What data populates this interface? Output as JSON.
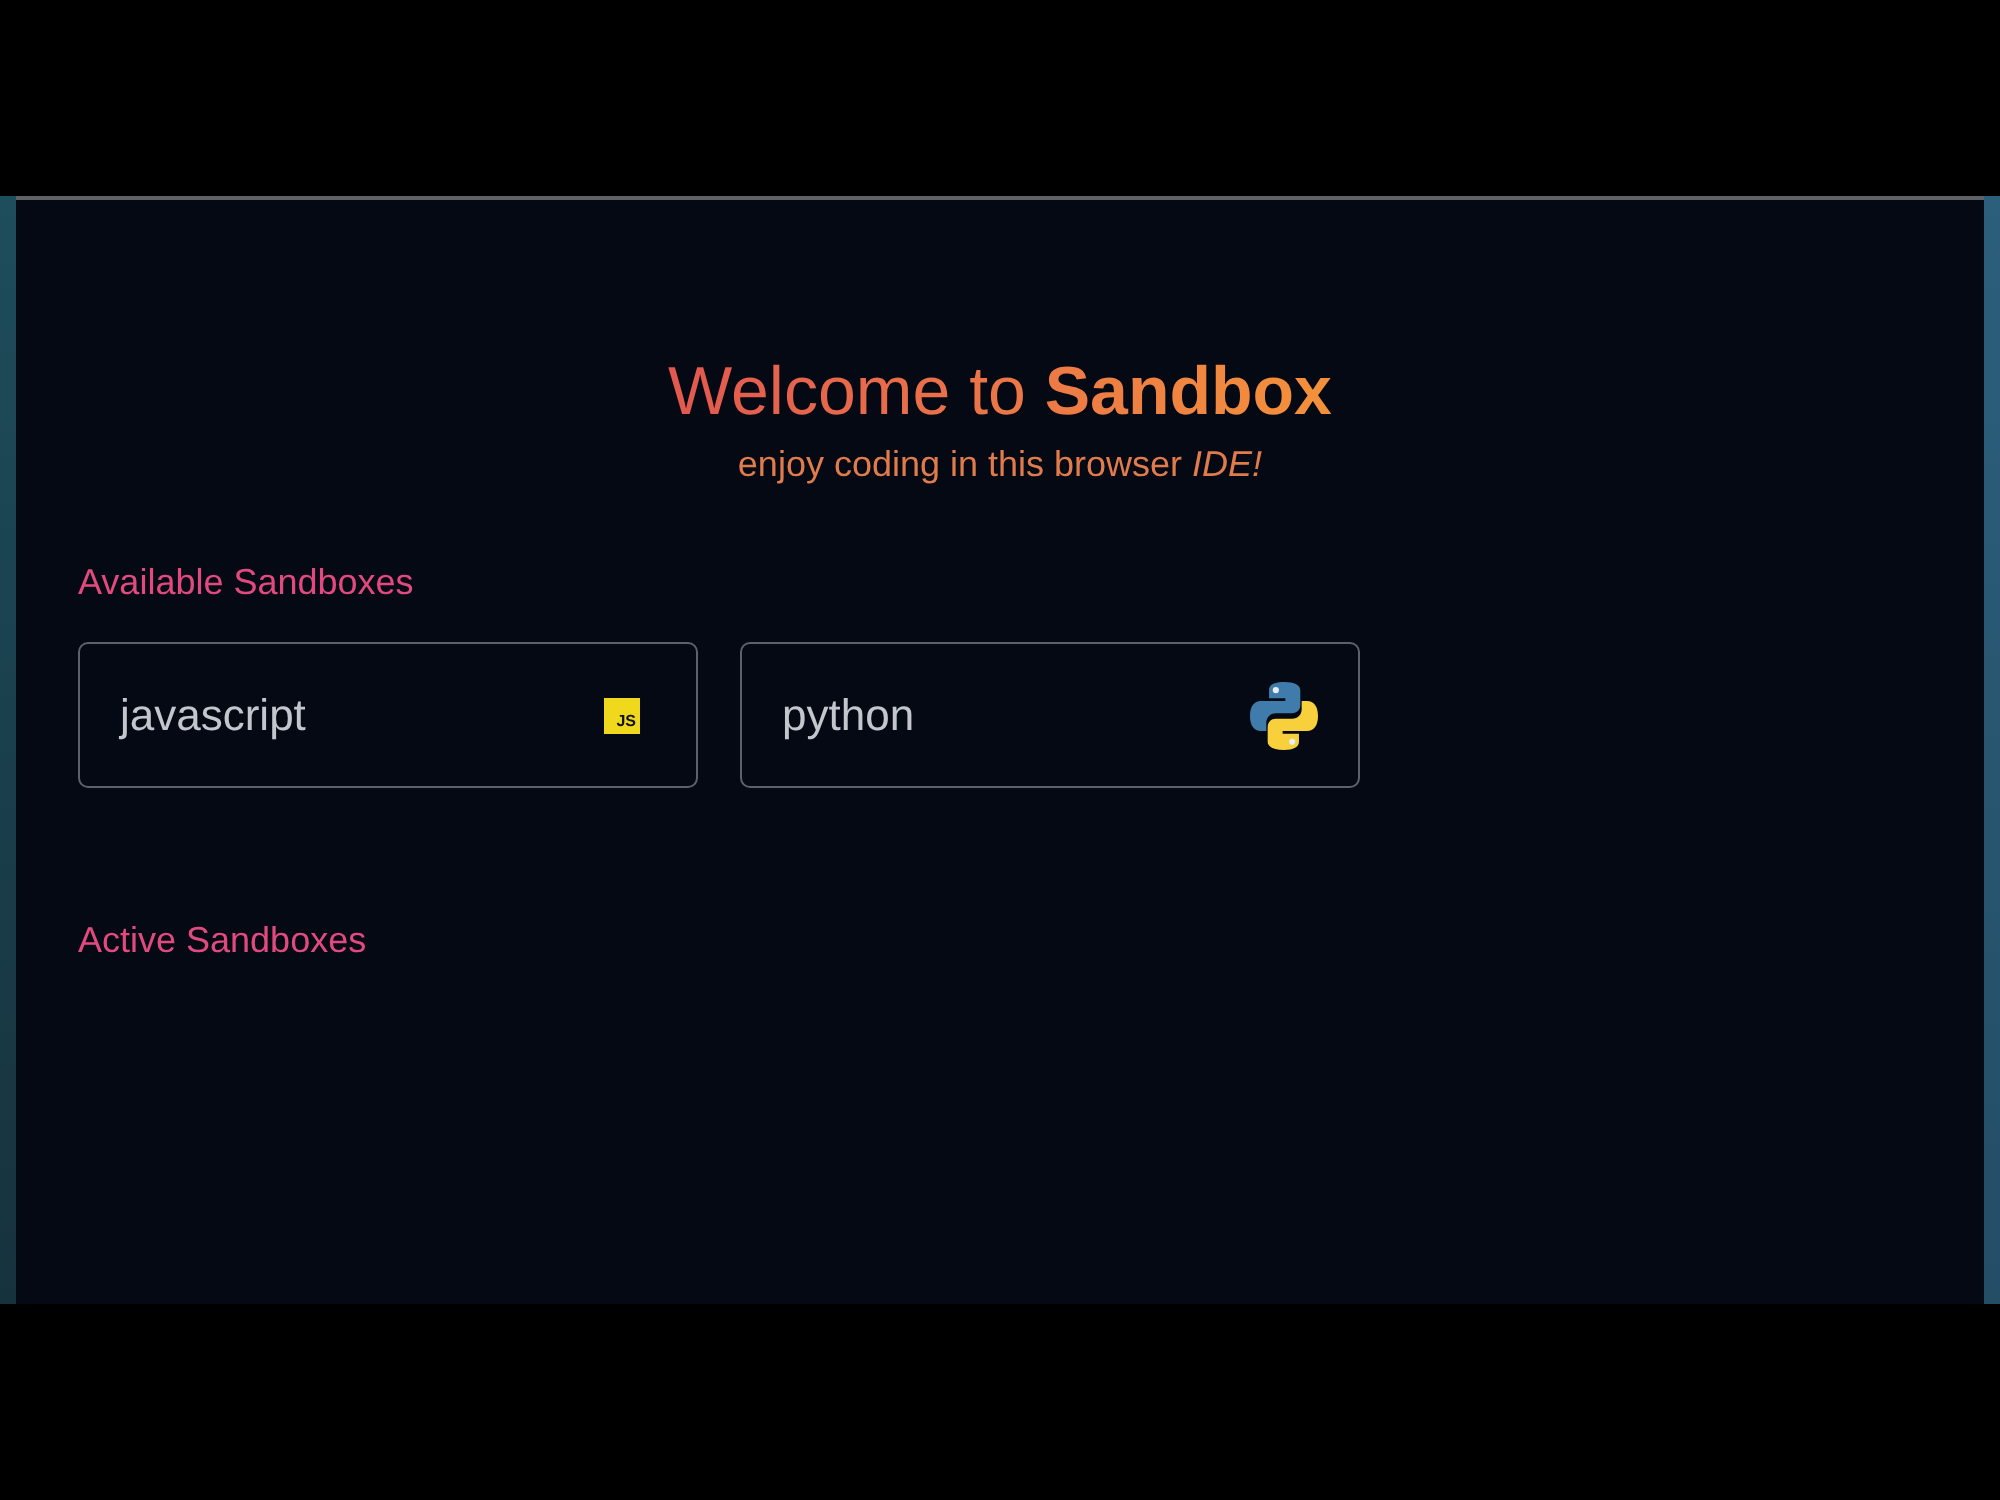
{
  "hero": {
    "title": "Welcome to **Sandbox**",
    "subtitle": "enjoy coding in this browser *IDE!*"
  },
  "sections": [
    {
      "heading": "Available Sandboxes",
      "cards": [
        {
          "label": "javascript",
          "kind": "javascript",
          "badge": "JS"
        },
        {
          "label": "python",
          "kind": "python"
        }
      ]
    },
    {
      "heading": "Active Sandboxes"
    }
  ]
}
